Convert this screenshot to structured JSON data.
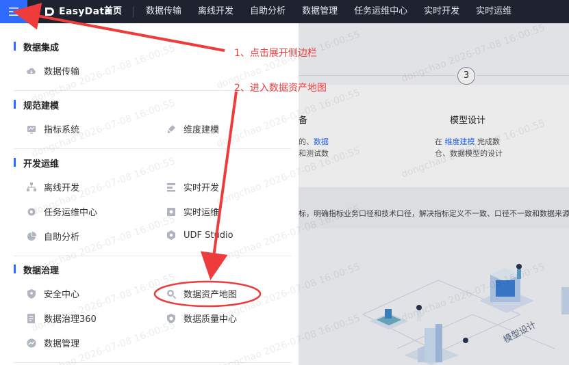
{
  "topbar": {
    "logo_text": "EasyData",
    "nav": [
      "首页",
      "数据传输",
      "离线开发",
      "自助分析",
      "数据管理",
      "任务运维中心",
      "实时开发",
      "实时运维"
    ]
  },
  "background": {
    "step_number": "3",
    "step_left_title": "备",
    "step_left_desc_1a": "的、",
    "step_left_desc_1b": "数据",
    "step_left_desc_2": "和测试数",
    "step_title": "模型设计",
    "step_desc_1a": "在 ",
    "step_desc_1b": "维度建模",
    "step_desc_1c": " 完成数",
    "step_desc_2": "仓、数据模型的设计",
    "band_text": "标，明确指标业务口径和技术口径，解决指标定义不一致、口径不一致和数据来源不",
    "illus_label": "模型设计"
  },
  "sidebar": {
    "sections": [
      {
        "title": "数据集成",
        "items": [
          {
            "label": "数据传输",
            "icon": "cloud-icon"
          }
        ]
      },
      {
        "title": "规范建模",
        "items": [
          {
            "label": "指标系统",
            "icon": "metric-icon"
          },
          {
            "label": "维度建模",
            "icon": "brush-icon"
          }
        ]
      },
      {
        "title": "开发运维",
        "items": [
          {
            "label": "离线开发",
            "icon": "tree-icon"
          },
          {
            "label": "实时开发",
            "icon": "stream-icon"
          },
          {
            "label": "任务运维中心",
            "icon": "gear-icon"
          },
          {
            "label": "实时运维",
            "icon": "monitor-icon"
          },
          {
            "label": "自助分析",
            "icon": "pie-icon"
          },
          {
            "label": "UDF Studio",
            "icon": "hexagon-icon"
          }
        ]
      },
      {
        "title": "数据治理",
        "items": [
          {
            "label": "安全中心",
            "icon": "shield-icon"
          },
          {
            "label": "数据资产地图",
            "icon": "map-search-icon"
          },
          {
            "label": "数据治理360",
            "icon": "doc-icon"
          },
          {
            "label": "数据质量中心",
            "icon": "shield-check-icon"
          },
          {
            "label": "数据管理",
            "icon": "chart-icon"
          }
        ]
      }
    ]
  },
  "annotations": {
    "step1": "1、点击展开侧边栏",
    "step2": "2、进入数据资产地图",
    "color": "#ee3b3b"
  },
  "watermark": "dongchao 2026-07-08 16:00:55"
}
